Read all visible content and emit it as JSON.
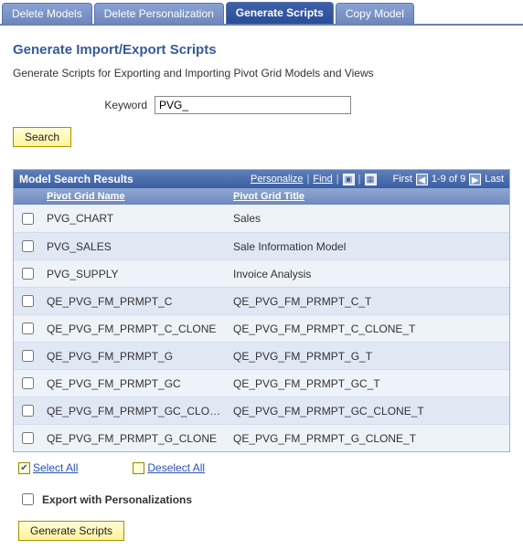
{
  "tabs": {
    "delete_models": "Delete Models",
    "delete_personalization": "Delete Personalization",
    "generate_scripts": "Generate Scripts",
    "copy_model": "Copy Model"
  },
  "page": {
    "title": "Generate Import/Export Scripts",
    "desc": "Generate Scripts for Exporting and Importing Pivot Grid Models and Views"
  },
  "keyword": {
    "label": "Keyword",
    "value": "PVG_"
  },
  "buttons": {
    "search": "Search",
    "generate": "Generate Scripts"
  },
  "grid": {
    "title": "Model Search Results",
    "toolbar": {
      "personalize": "Personalize",
      "find": "Find",
      "first": "First",
      "range": "1-9 of 9",
      "last": "Last"
    },
    "columns": {
      "name": "Pivot Grid Name",
      "title": "Pivot Grid Title"
    },
    "rows": [
      {
        "checked": false,
        "name": "PVG_CHART",
        "title": "Sales"
      },
      {
        "checked": false,
        "name": "PVG_SALES",
        "title": "Sale Information Model"
      },
      {
        "checked": false,
        "name": "PVG_SUPPLY",
        "title": "Invoice Analysis"
      },
      {
        "checked": false,
        "name": "QE_PVG_FM_PRMPT_C",
        "title": "QE_PVG_FM_PRMPT_C_T"
      },
      {
        "checked": false,
        "name": "QE_PVG_FM_PRMPT_C_CLONE",
        "title": "QE_PVG_FM_PRMPT_C_CLONE_T"
      },
      {
        "checked": false,
        "name": "QE_PVG_FM_PRMPT_G",
        "title": "QE_PVG_FM_PRMPT_G_T"
      },
      {
        "checked": false,
        "name": "QE_PVG_FM_PRMPT_GC",
        "title": "QE_PVG_FM_PRMPT_GC_T"
      },
      {
        "checked": false,
        "name": "QE_PVG_FM_PRMPT_GC_CLONE",
        "title": "QE_PVG_FM_PRMPT_GC_CLONE_T"
      },
      {
        "checked": false,
        "name": "QE_PVG_FM_PRMPT_G_CLONE",
        "title": "QE_PVG_FM_PRMPT_G_CLONE_T"
      }
    ]
  },
  "selection": {
    "select_all": "Select All",
    "deselect_all": "Deselect All"
  },
  "export": {
    "label": "Export with Personalizations",
    "checked": false
  }
}
